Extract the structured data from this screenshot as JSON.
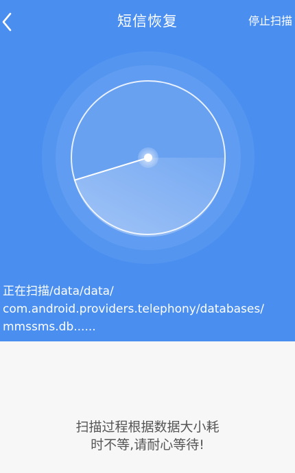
{
  "header": {
    "back_icon": "chevron-left-icon",
    "title": "短信恢复",
    "stop_label": "停止扫描"
  },
  "radar": {
    "icon": "radar-scan-icon"
  },
  "scan_status": {
    "line1": "正在扫描/data/data/",
    "line2": "com.android.providers.telephony/databases/",
    "line3": "mmssms.db......"
  },
  "hint": {
    "line1": "扫描过程根据数据大小耗",
    "line2": "时不等,请耐心等待!"
  },
  "colors": {
    "primary_blue": "#4a8ff0",
    "background": "#f7f7f7",
    "hint_text": "#555555"
  }
}
